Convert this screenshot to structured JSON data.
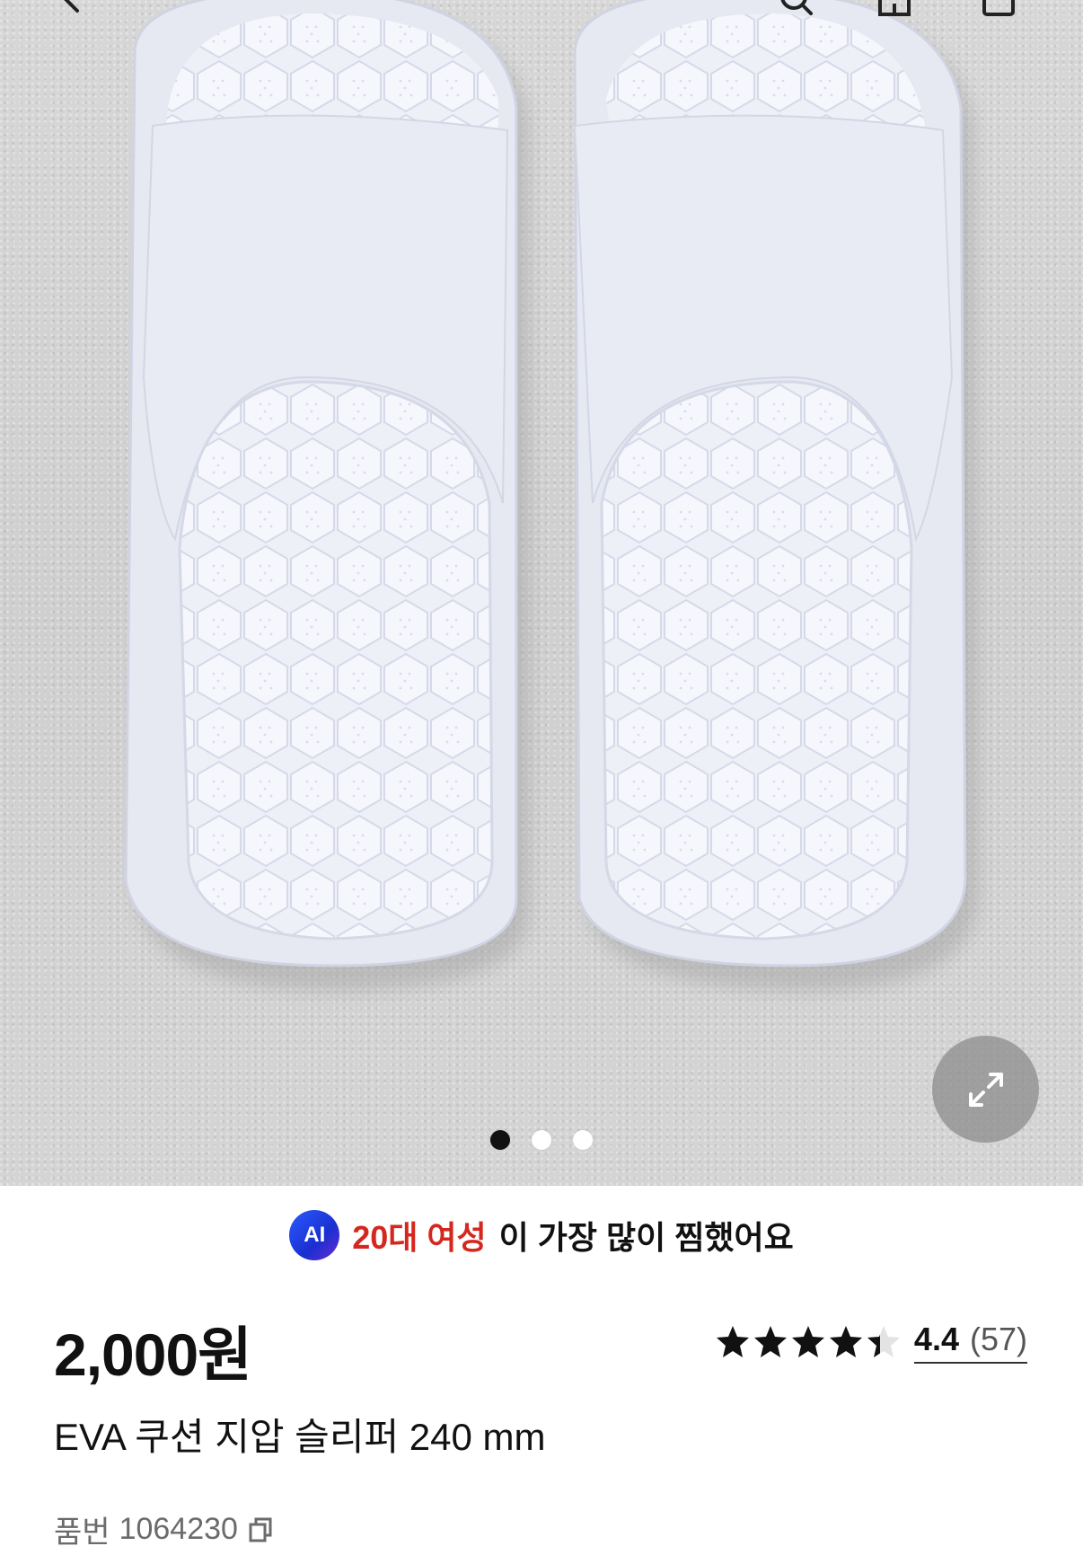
{
  "hero": {
    "gallery_dots": [
      {
        "active": true
      },
      {
        "active": false
      },
      {
        "active": false
      }
    ],
    "icons": {
      "back": "chevron-left-icon",
      "search": "search-icon",
      "home": "home-icon",
      "cart": "cart-icon",
      "expand": "expand-icon"
    }
  },
  "ai_banner": {
    "badge": "AI",
    "highlight": "20대 여성",
    "rest": "이 가장 많이 찜했어요",
    "highlight_color": "#d4281e"
  },
  "product": {
    "price": "2,000원",
    "rating_value": 4.4,
    "rating_score": "4.4",
    "rating_count": "(57)",
    "title": "EVA 쿠션 지압 슬리퍼 240 mm",
    "sku_label": "품번",
    "sku_value": "1064230"
  }
}
